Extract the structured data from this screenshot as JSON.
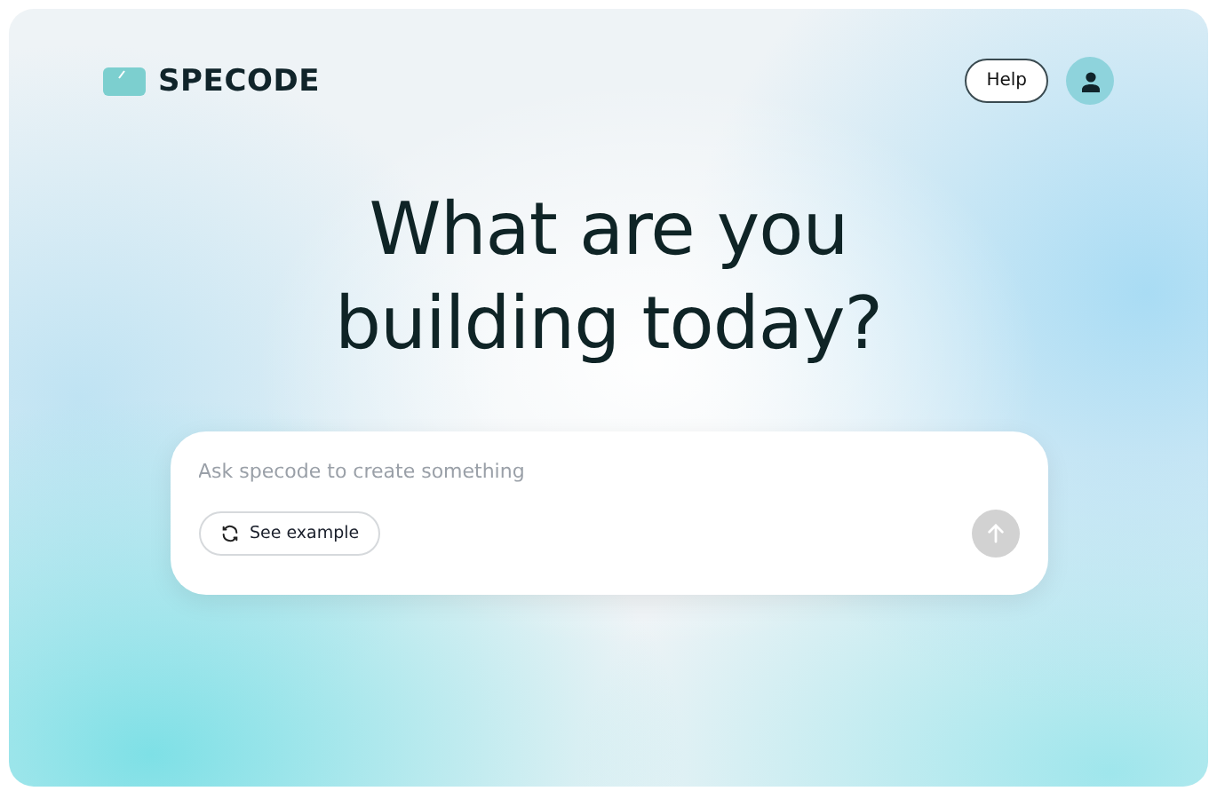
{
  "header": {
    "logo_text": "SPECODE",
    "help_button": "Help"
  },
  "headline": "What are you building today?",
  "prompt": {
    "placeholder": "Ask specode to create something",
    "example_button": "See example",
    "send_disabled": true
  }
}
